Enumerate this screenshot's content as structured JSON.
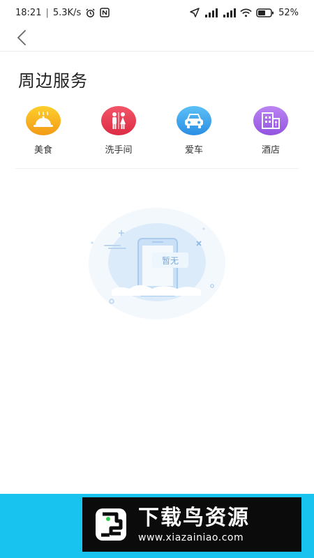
{
  "status_bar": {
    "time": "18:21",
    "speed": "5.3K/s",
    "battery": "52%"
  },
  "nav": {
    "back_icon": "chevron-left-icon"
  },
  "page": {
    "title": "周边服务"
  },
  "services": [
    {
      "label": "美食",
      "icon": "food-dome-icon",
      "color": "#f7a81d"
    },
    {
      "label": "洗手间",
      "icon": "restroom-icon",
      "color": "#e8364c"
    },
    {
      "label": "爱车",
      "icon": "car-icon",
      "color": "#3ba3ee"
    },
    {
      "label": "酒店",
      "icon": "hotel-icon",
      "color": "#a766e8"
    }
  ],
  "empty_state": {
    "text": "暂无"
  },
  "watermark": {
    "title": "下载鸟资源",
    "url": "www.xiazainiao.com"
  },
  "colors": {
    "banner": "#19c3ef",
    "watermark_bg": "#0b0b0b"
  }
}
